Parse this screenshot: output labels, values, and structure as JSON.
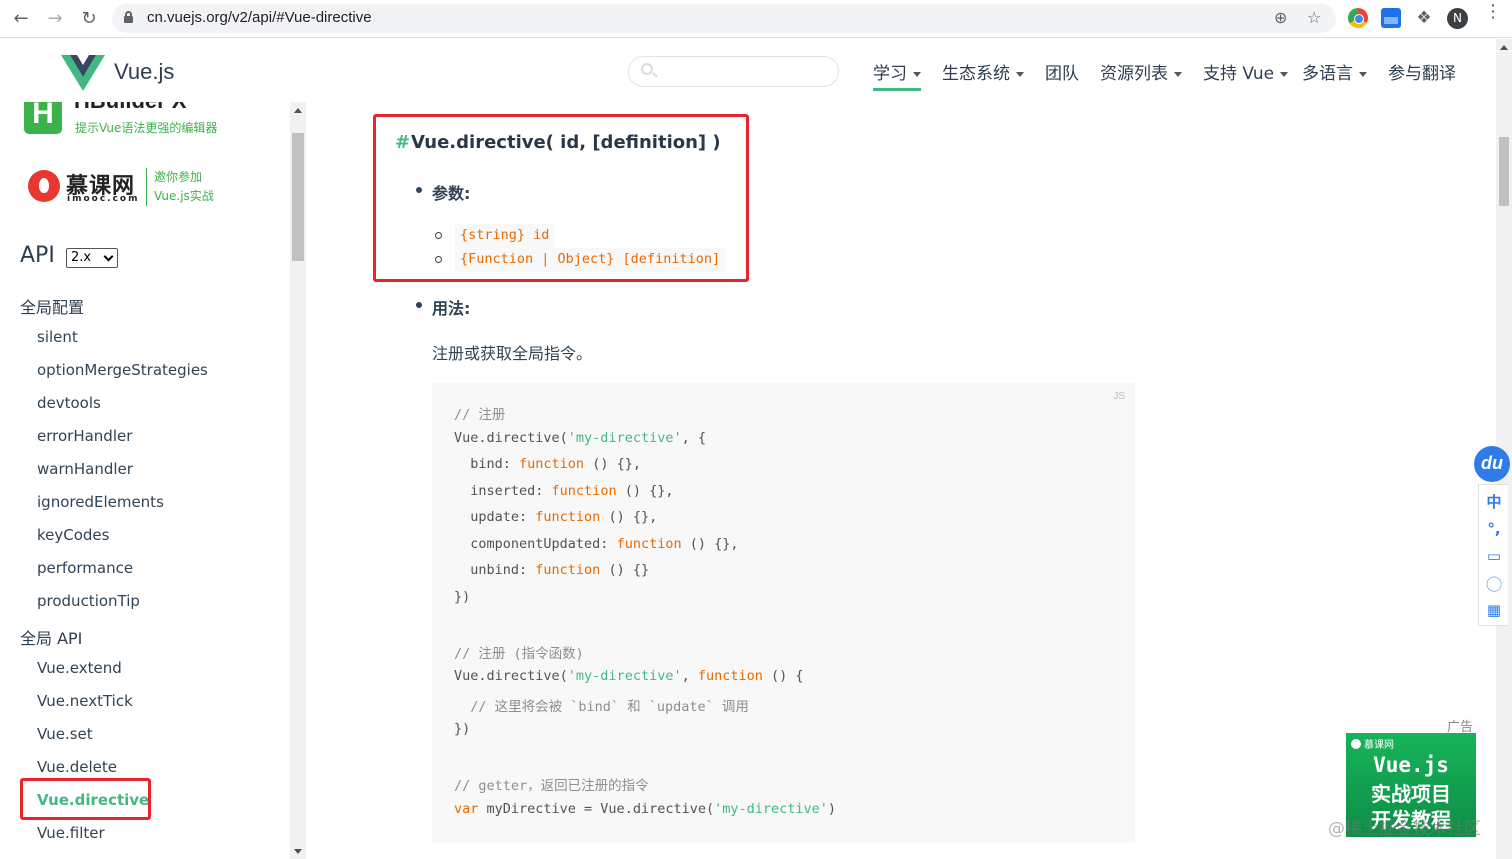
{
  "browser": {
    "url": "cn.vuejs.org/v2/api/#Vue-directive",
    "profile_initial": "N",
    "icons": [
      "back-icon",
      "forward-icon",
      "reload-icon",
      "lock-icon",
      "install-icon",
      "star-icon",
      "chrome-ext-icon",
      "image-ext-icon",
      "puzzle-icon",
      "menu-icon"
    ]
  },
  "header": {
    "logo_text": "Vue.js",
    "nav": [
      {
        "label": "学习",
        "dropdown": true,
        "active": true
      },
      {
        "label": "生态系统",
        "dropdown": true
      },
      {
        "label": "团队",
        "dropdown": false
      },
      {
        "label": "资源列表",
        "dropdown": true
      },
      {
        "label": "支持 Vue",
        "dropdown": true
      },
      {
        "label": "多语言",
        "dropdown": true
      },
      {
        "label": "参与翻译",
        "dropdown": false
      }
    ]
  },
  "sidebar": {
    "ads": {
      "hbuilder_title": "HBuilder X",
      "hbuilder_sub": "提示Vue语法更强的编辑器",
      "imooc_name": "慕课网",
      "imooc_domain": "imooc.com",
      "imooc_t1": "邀你参加",
      "imooc_t2": "Vue.js实战"
    },
    "api_title": "API",
    "version": "2.x",
    "section_global_config": "全局配置",
    "global_config_items": [
      "silent",
      "optionMergeStrategies",
      "devtools",
      "errorHandler",
      "warnHandler",
      "ignoredElements",
      "keyCodes",
      "performance",
      "productionTip"
    ],
    "section_global_api": "全局 API",
    "global_api_items": [
      "Vue.extend",
      "Vue.nextTick",
      "Vue.set",
      "Vue.delete",
      "Vue.directive",
      "Vue.filter"
    ],
    "current_item": "Vue.directive"
  },
  "content": {
    "heading_anchor": "#",
    "heading": "Vue.directive( id, [definition] )",
    "params_label": "参数",
    "params": [
      "{string} id",
      "{Function | Object} [definition]"
    ],
    "usage_label": "用法",
    "usage_text": "注册或获取全局指令。",
    "code_lang": "JS",
    "code_lines": [
      "// 注册",
      "Vue.directive('my-directive', {",
      "  bind: function () {},",
      "  inserted: function () {},",
      "  update: function () {},",
      "  componentUpdated: function () {},",
      "  unbind: function () {}",
      "})",
      "",
      "// 注册 (指令函数)",
      "Vue.directive('my-directive', function () {",
      "  // 这里将会被 `bind` 和 `update` 调用",
      "})",
      "",
      "// getter，返回已注册的指令",
      "var myDirective = Vue.directive('my-directive')"
    ]
  },
  "widgets": {
    "du_label": "du",
    "tools": [
      "中",
      "°,",
      "▭",
      "◯",
      "▦"
    ],
    "ad_label": "广告",
    "ad_brand": "慕课网",
    "ad_line1": "Vue.js",
    "ad_line2": "实战项目",
    "ad_line3": "开发教程",
    "watermark": "@稀土掘金技术社区"
  },
  "colors": {
    "accent": "#42b983",
    "annotation_red": "#e8232a",
    "keyword": "#e96900"
  }
}
